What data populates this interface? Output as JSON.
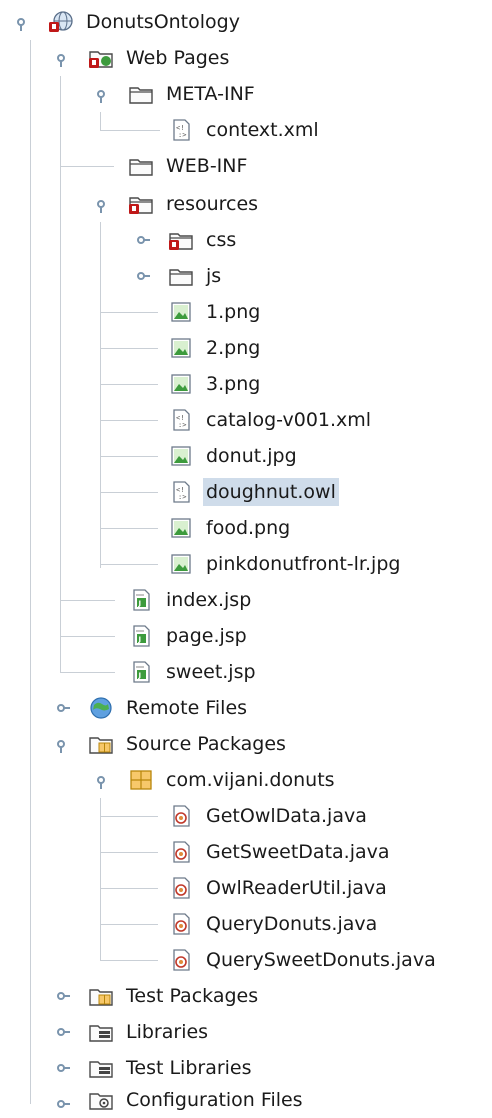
{
  "tree": {
    "root": "DonutsOntology",
    "web_pages": "Web Pages",
    "meta_inf": "META-INF",
    "context_xml": "context.xml",
    "web_inf": "WEB-INF",
    "resources": "resources",
    "css": "css",
    "js": "js",
    "png1": "1.png",
    "png2": "2.png",
    "png3": "3.png",
    "catalog": "catalog-v001.xml",
    "donut_jpg": "donut.jpg",
    "doughnut_owl": "doughnut.owl",
    "food_png": "food.png",
    "pinkdonut": "pinkdonutfront-lr.jpg",
    "index_jsp": "index.jsp",
    "page_jsp": "page.jsp",
    "sweet_jsp": "sweet.jsp",
    "remote_files": "Remote Files",
    "source_packages": "Source Packages",
    "package": "com.vijani.donuts",
    "getowl": "GetOwlData.java",
    "getsweet": "GetSweetData.java",
    "owlreader": "OwlReaderUtil.java",
    "querydonuts": "QueryDonuts.java",
    "querysweet": "QuerySweetDonuts.java",
    "test_packages": "Test Packages",
    "libraries": "Libraries",
    "test_libraries": "Test Libraries",
    "config_files": "Configuration Files"
  },
  "selected": "doughnut.owl",
  "colors": {
    "selection": "#cfdcea",
    "tree_line": "#c9cfd6",
    "handle": "#7a94ad"
  }
}
